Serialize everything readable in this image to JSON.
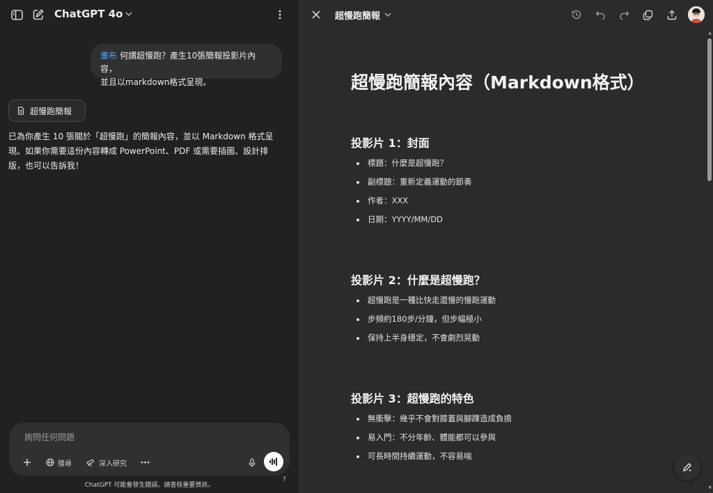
{
  "left": {
    "model_name": "ChatGPT 4o",
    "user_message": {
      "tag": "畫布",
      "line1": "何謂超慢跑？產生10張簡報投影片內容，",
      "line2": "並且以markdown格式呈現。"
    },
    "canvas_chip_label": "超慢跑簡報",
    "reply_text": "已為你產生 10 張關於「超慢跑」的簡報內容，並以 Markdown 格式呈現。如果你需要這份內容轉成 PowerPoint、PDF 或需要插圖、設計排版，也可以告訴我！",
    "composer": {
      "placeholder": "詢問任何問題",
      "search_label": "搜尋",
      "deep_research_label": "深入研究"
    },
    "disclaimer": "ChatGPT 可能會發生錯誤。請查核重要資訊。",
    "help": "?"
  },
  "canvas": {
    "title": "超慢跑簡報",
    "doc_title": "超慢跑簡報內容（Markdown格式）",
    "sections": [
      {
        "heading": "投影片 1：封面",
        "items": [
          "標題：什麼是超慢跑？",
          "副標題：重新定義運動的節奏",
          "作者：XXX",
          "日期：YYYY/MM/DD"
        ]
      },
      {
        "heading": "投影片 2：什麼是超慢跑？",
        "items": [
          "超慢跑是一種比快走還慢的慢跑運動",
          "步頻約180步/分鐘，但步幅極小",
          "保持上半身穩定，不會劇烈晃動"
        ]
      },
      {
        "heading": "投影片 3：超慢跑的特色",
        "items": [
          "無衝擊：幾乎不會對膝蓋與腳踝造成負擔",
          "易入門：不分年齡、體能都可以參與",
          "可長時間持續運動，不容易喘"
        ]
      }
    ]
  },
  "colors": {
    "canvas_tag": "#4aa3ff",
    "left_bg": "#212121",
    "right_bg": "#2b2b2b"
  }
}
